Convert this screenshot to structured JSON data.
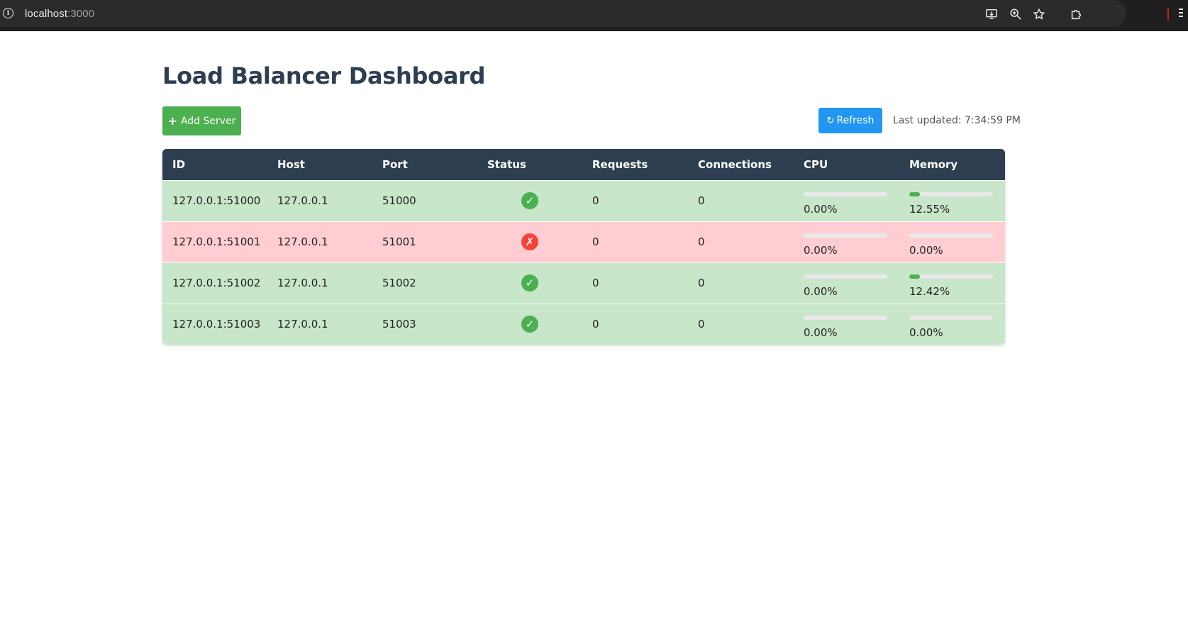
{
  "browser": {
    "url_host": "localhost",
    "url_port": ":3000"
  },
  "page": {
    "title": "Load Balancer Dashboard",
    "add_button_label": "Add Server",
    "refresh_button_label": "Refresh",
    "last_updated": "Last updated: 7:34:59 PM"
  },
  "table": {
    "headers": [
      "ID",
      "Host",
      "Port",
      "Status",
      "Requests",
      "Connections",
      "CPU",
      "Memory"
    ],
    "rows": [
      {
        "id": "127.0.0.1:51000",
        "host": "127.0.0.1",
        "port": "51000",
        "status": "healthy",
        "status_glyph": "✓",
        "requests": "0",
        "connections": "0",
        "cpu": "0.00%",
        "cpu_fraction": 0.0,
        "memory": "12.55%",
        "memory_fraction": 0.1255
      },
      {
        "id": "127.0.0.1:51001",
        "host": "127.0.0.1",
        "port": "51001",
        "status": "unhealthy",
        "status_glyph": "✗",
        "requests": "0",
        "connections": "0",
        "cpu": "0.00%",
        "cpu_fraction": 0.0,
        "memory": "0.00%",
        "memory_fraction": 0.0
      },
      {
        "id": "127.0.0.1:51002",
        "host": "127.0.0.1",
        "port": "51002",
        "status": "healthy",
        "status_glyph": "✓",
        "requests": "0",
        "connections": "0",
        "cpu": "0.00%",
        "cpu_fraction": 0.0,
        "memory": "12.42%",
        "memory_fraction": 0.1242
      },
      {
        "id": "127.0.0.1:51003",
        "host": "127.0.0.1",
        "port": "51003",
        "status": "healthy",
        "status_glyph": "✓",
        "requests": "0",
        "connections": "0",
        "cpu": "0.00%",
        "cpu_fraction": 0.0,
        "memory": "0.00%",
        "memory_fraction": 0.0
      }
    ]
  },
  "colors": {
    "header_bg": "#2c3e50",
    "healthy_row": "#c8e6c9",
    "unhealthy_row": "#ffcdd2",
    "add_button": "#4caf50",
    "refresh_button": "#2196f3",
    "status_ok": "#4caf50",
    "status_bad": "#f44336"
  },
  "icons": {
    "site_info": "info-icon",
    "install": "install-app-icon",
    "zoom": "zoom-icon",
    "bookmark": "star-icon",
    "extensions": "puzzle-icon",
    "menu": "menu-icon",
    "add": "plus-icon",
    "refresh": "refresh-icon"
  }
}
